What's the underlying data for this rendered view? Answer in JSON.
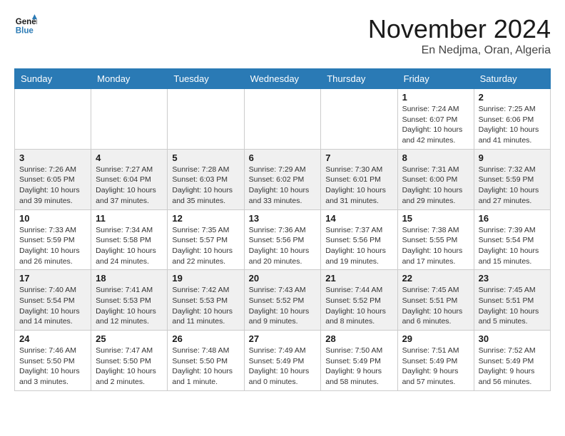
{
  "header": {
    "logo_line1": "General",
    "logo_line2": "Blue",
    "month": "November 2024",
    "location": "En Nedjma, Oran, Algeria"
  },
  "weekdays": [
    "Sunday",
    "Monday",
    "Tuesday",
    "Wednesday",
    "Thursday",
    "Friday",
    "Saturday"
  ],
  "weeks": [
    [
      {
        "day": "",
        "info": ""
      },
      {
        "day": "",
        "info": ""
      },
      {
        "day": "",
        "info": ""
      },
      {
        "day": "",
        "info": ""
      },
      {
        "day": "",
        "info": ""
      },
      {
        "day": "1",
        "info": "Sunrise: 7:24 AM\nSunset: 6:07 PM\nDaylight: 10 hours and 42 minutes."
      },
      {
        "day": "2",
        "info": "Sunrise: 7:25 AM\nSunset: 6:06 PM\nDaylight: 10 hours and 41 minutes."
      }
    ],
    [
      {
        "day": "3",
        "info": "Sunrise: 7:26 AM\nSunset: 6:05 PM\nDaylight: 10 hours and 39 minutes."
      },
      {
        "day": "4",
        "info": "Sunrise: 7:27 AM\nSunset: 6:04 PM\nDaylight: 10 hours and 37 minutes."
      },
      {
        "day": "5",
        "info": "Sunrise: 7:28 AM\nSunset: 6:03 PM\nDaylight: 10 hours and 35 minutes."
      },
      {
        "day": "6",
        "info": "Sunrise: 7:29 AM\nSunset: 6:02 PM\nDaylight: 10 hours and 33 minutes."
      },
      {
        "day": "7",
        "info": "Sunrise: 7:30 AM\nSunset: 6:01 PM\nDaylight: 10 hours and 31 minutes."
      },
      {
        "day": "8",
        "info": "Sunrise: 7:31 AM\nSunset: 6:00 PM\nDaylight: 10 hours and 29 minutes."
      },
      {
        "day": "9",
        "info": "Sunrise: 7:32 AM\nSunset: 5:59 PM\nDaylight: 10 hours and 27 minutes."
      }
    ],
    [
      {
        "day": "10",
        "info": "Sunrise: 7:33 AM\nSunset: 5:59 PM\nDaylight: 10 hours and 26 minutes."
      },
      {
        "day": "11",
        "info": "Sunrise: 7:34 AM\nSunset: 5:58 PM\nDaylight: 10 hours and 24 minutes."
      },
      {
        "day": "12",
        "info": "Sunrise: 7:35 AM\nSunset: 5:57 PM\nDaylight: 10 hours and 22 minutes."
      },
      {
        "day": "13",
        "info": "Sunrise: 7:36 AM\nSunset: 5:56 PM\nDaylight: 10 hours and 20 minutes."
      },
      {
        "day": "14",
        "info": "Sunrise: 7:37 AM\nSunset: 5:56 PM\nDaylight: 10 hours and 19 minutes."
      },
      {
        "day": "15",
        "info": "Sunrise: 7:38 AM\nSunset: 5:55 PM\nDaylight: 10 hours and 17 minutes."
      },
      {
        "day": "16",
        "info": "Sunrise: 7:39 AM\nSunset: 5:54 PM\nDaylight: 10 hours and 15 minutes."
      }
    ],
    [
      {
        "day": "17",
        "info": "Sunrise: 7:40 AM\nSunset: 5:54 PM\nDaylight: 10 hours and 14 minutes."
      },
      {
        "day": "18",
        "info": "Sunrise: 7:41 AM\nSunset: 5:53 PM\nDaylight: 10 hours and 12 minutes."
      },
      {
        "day": "19",
        "info": "Sunrise: 7:42 AM\nSunset: 5:53 PM\nDaylight: 10 hours and 11 minutes."
      },
      {
        "day": "20",
        "info": "Sunrise: 7:43 AM\nSunset: 5:52 PM\nDaylight: 10 hours and 9 minutes."
      },
      {
        "day": "21",
        "info": "Sunrise: 7:44 AM\nSunset: 5:52 PM\nDaylight: 10 hours and 8 minutes."
      },
      {
        "day": "22",
        "info": "Sunrise: 7:45 AM\nSunset: 5:51 PM\nDaylight: 10 hours and 6 minutes."
      },
      {
        "day": "23",
        "info": "Sunrise: 7:45 AM\nSunset: 5:51 PM\nDaylight: 10 hours and 5 minutes."
      }
    ],
    [
      {
        "day": "24",
        "info": "Sunrise: 7:46 AM\nSunset: 5:50 PM\nDaylight: 10 hours and 3 minutes."
      },
      {
        "day": "25",
        "info": "Sunrise: 7:47 AM\nSunset: 5:50 PM\nDaylight: 10 hours and 2 minutes."
      },
      {
        "day": "26",
        "info": "Sunrise: 7:48 AM\nSunset: 5:50 PM\nDaylight: 10 hours and 1 minute."
      },
      {
        "day": "27",
        "info": "Sunrise: 7:49 AM\nSunset: 5:49 PM\nDaylight: 10 hours and 0 minutes."
      },
      {
        "day": "28",
        "info": "Sunrise: 7:50 AM\nSunset: 5:49 PM\nDaylight: 9 hours and 58 minutes."
      },
      {
        "day": "29",
        "info": "Sunrise: 7:51 AM\nSunset: 5:49 PM\nDaylight: 9 hours and 57 minutes."
      },
      {
        "day": "30",
        "info": "Sunrise: 7:52 AM\nSunset: 5:49 PM\nDaylight: 9 hours and 56 minutes."
      }
    ]
  ]
}
